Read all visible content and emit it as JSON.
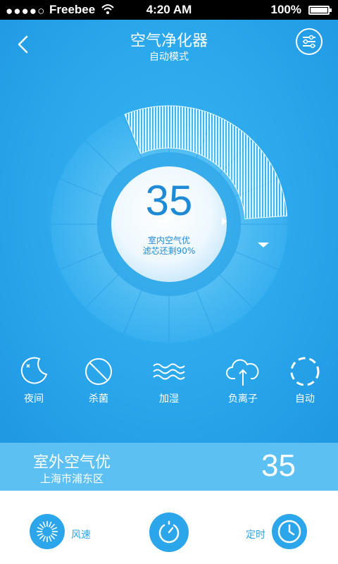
{
  "status_bar": {
    "signal_dots": "●●●●○",
    "carrier": "Freebee",
    "time": "4:20 AM",
    "battery": "100%"
  },
  "header": {
    "title": "空气净化器",
    "subtitle": "自动模式"
  },
  "dial": {
    "value": "35",
    "status_text": "室内空气优",
    "filter_text": "滤芯还剩90%",
    "fill_fraction": 0.3
  },
  "modes": [
    {
      "label": "夜间",
      "icon": "moon-icon"
    },
    {
      "label": "杀菌",
      "icon": "sterilize-icon"
    },
    {
      "label": "加湿",
      "icon": "waves-icon"
    },
    {
      "label": "负离子",
      "icon": "cloud-upload-icon"
    },
    {
      "label": "自动",
      "icon": "dashed-circle-icon"
    }
  ],
  "outdoor": {
    "title": "室外空气优",
    "location": "上海市浦东区",
    "value": "35"
  },
  "bottom": {
    "wind_label": "风速",
    "timer_label": "定时"
  },
  "colors": {
    "primary": "#2ba6ea",
    "outdoor_bar": "#5dc0f3",
    "dial_text": "#1f8bd6"
  }
}
